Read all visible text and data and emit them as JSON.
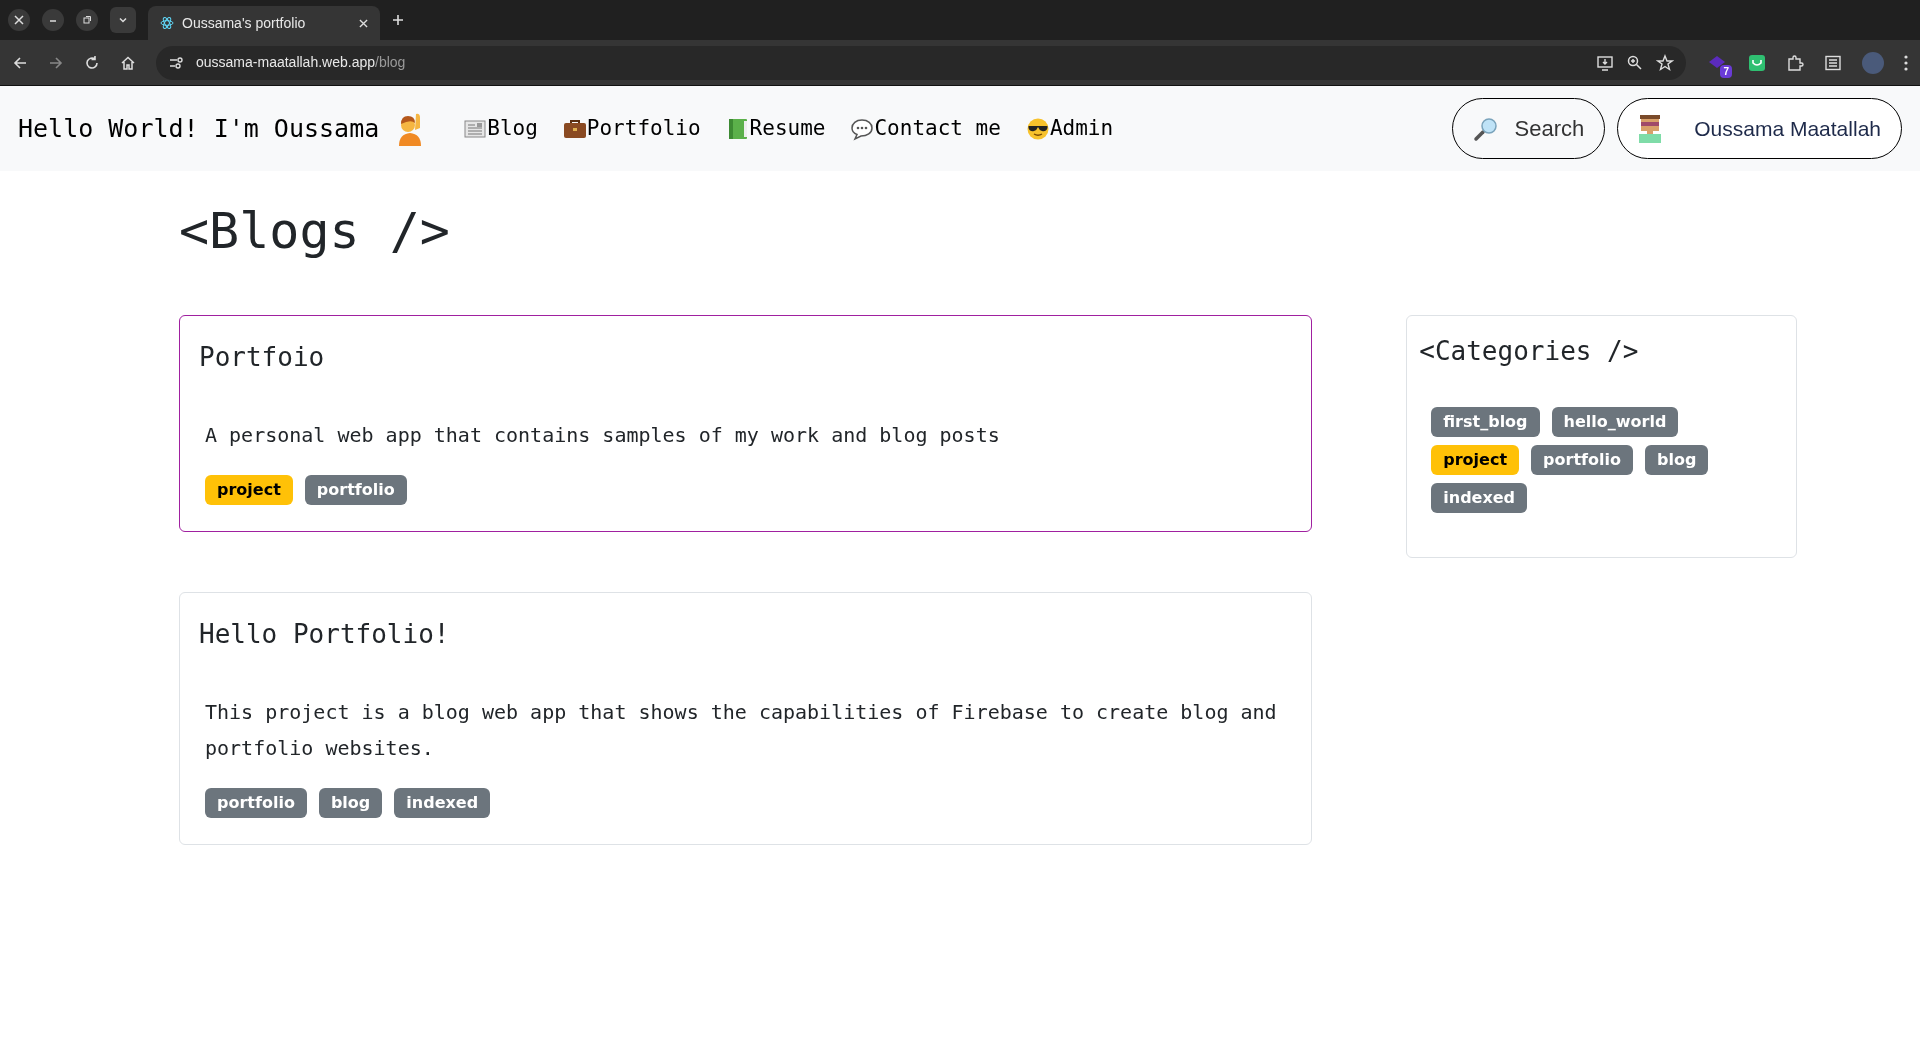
{
  "browser": {
    "tab_title": "Oussama's portfolio",
    "url_host": "oussama-maatallah.web.app",
    "url_path": "/blog",
    "extension_badge": "7"
  },
  "navbar": {
    "brand": "Hello World! I'm Oussama",
    "links": [
      {
        "label": "Blog"
      },
      {
        "label": "Portfolio"
      },
      {
        "label": "Resume"
      },
      {
        "label": "Contact me"
      },
      {
        "label": "Admin"
      }
    ],
    "search_button": "Search",
    "user_button": "Oussama Maatallah"
  },
  "page_title": "<Blogs />",
  "posts": [
    {
      "title": "Portfoio",
      "selected": true,
      "summary": "A personal web app that contains samples of my work and blog posts",
      "tags": [
        {
          "label": "project",
          "selected": true
        },
        {
          "label": "portfolio",
          "selected": false
        }
      ]
    },
    {
      "title": "Hello Portfolio!",
      "selected": false,
      "summary": "This project is a blog web app that shows the capabilities of Firebase to create blog and portfolio websites.",
      "tags": [
        {
          "label": "portfolio",
          "selected": false
        },
        {
          "label": "blog",
          "selected": false
        },
        {
          "label": "indexed",
          "selected": false
        }
      ]
    }
  ],
  "categories": {
    "title": "<Categories />",
    "tags": [
      {
        "label": "first_blog",
        "selected": false
      },
      {
        "label": "hello_world",
        "selected": false
      },
      {
        "label": "project",
        "selected": true
      },
      {
        "label": "portfolio",
        "selected": false
      },
      {
        "label": "blog",
        "selected": false
      },
      {
        "label": "indexed",
        "selected": false
      }
    ]
  }
}
